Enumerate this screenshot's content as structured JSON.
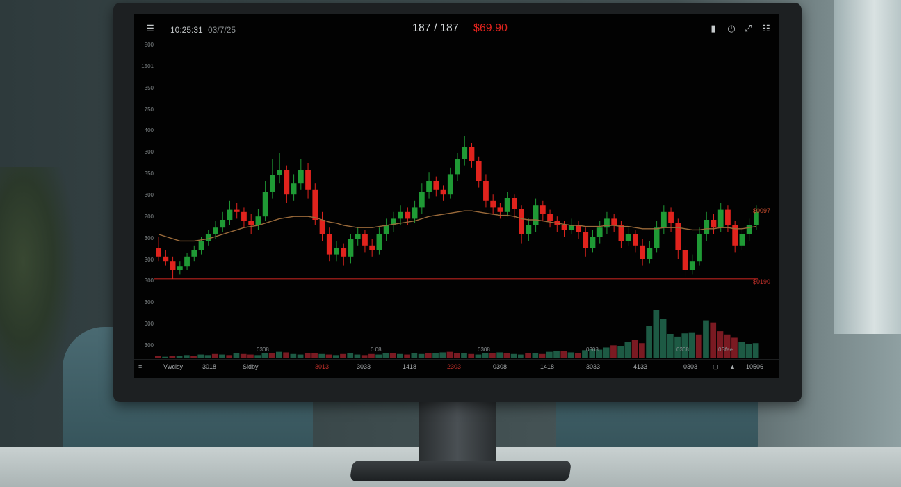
{
  "topbar": {
    "time": "10:25:31",
    "date": "03/7/25",
    "price_main": "187 / 187",
    "price_change": "$69.90",
    "colors": {
      "up": "#1f9a35",
      "down": "#e0231d",
      "ma_line": "#9a6a3a",
      "support_line": "#b8221c"
    },
    "icons": [
      "menu-icon",
      "bookmark-icon",
      "clock-icon",
      "expand-icon",
      "layout-icon"
    ]
  },
  "yaxis": {
    "labels": [
      "500",
      "1501",
      "350",
      "750",
      "400",
      "300",
      "350",
      "300",
      "200",
      "300",
      "300",
      "300",
      "300",
      "900",
      "300"
    ]
  },
  "price_labels": {
    "ma_price": "$0097",
    "support_price": "$0190"
  },
  "sub_labels": [
    "0308",
    "0.08",
    "0308",
    "0308",
    "0308",
    "0Sfee"
  ],
  "bottombar": {
    "items": [
      "Vwcisy",
      "3018",
      "Sidby",
      "3013",
      "3033",
      "1418",
      "2303",
      "0308",
      "1418",
      "3033",
      "4133",
      "0303",
      "10506"
    ]
  },
  "chart_data": {
    "type": "candlestick",
    "ohlc": [
      [
        360,
        352,
        370,
        348
      ],
      [
        352,
        348,
        358,
        344
      ],
      [
        348,
        340,
        352,
        332
      ],
      [
        340,
        343,
        348,
        336
      ],
      [
        343,
        352,
        355,
        340
      ],
      [
        352,
        358,
        362,
        348
      ],
      [
        358,
        366,
        370,
        354
      ],
      [
        366,
        372,
        376,
        362
      ],
      [
        372,
        378,
        384,
        368
      ],
      [
        378,
        385,
        392,
        374
      ],
      [
        385,
        394,
        402,
        380
      ],
      [
        394,
        392,
        400,
        386
      ],
      [
        392,
        384,
        396,
        378
      ],
      [
        384,
        380,
        390,
        372
      ],
      [
        380,
        388,
        395,
        376
      ],
      [
        388,
        410,
        420,
        384
      ],
      [
        410,
        425,
        440,
        404
      ],
      [
        425,
        430,
        445,
        418
      ],
      [
        430,
        408,
        434,
        400
      ],
      [
        408,
        418,
        426,
        402
      ],
      [
        418,
        430,
        440,
        412
      ],
      [
        430,
        412,
        436,
        404
      ],
      [
        412,
        385,
        418,
        380
      ],
      [
        385,
        372,
        392,
        366
      ],
      [
        372,
        354,
        378,
        348
      ],
      [
        354,
        360,
        366,
        348
      ],
      [
        360,
        352,
        364,
        344
      ],
      [
        352,
        368,
        372,
        346
      ],
      [
        368,
        372,
        378,
        362
      ],
      [
        372,
        362,
        376,
        356
      ],
      [
        362,
        358,
        368,
        352
      ],
      [
        358,
        372,
        378,
        354
      ],
      [
        372,
        380,
        386,
        366
      ],
      [
        380,
        386,
        392,
        374
      ],
      [
        386,
        392,
        398,
        380
      ],
      [
        392,
        386,
        396,
        380
      ],
      [
        386,
        396,
        402,
        382
      ],
      [
        396,
        410,
        418,
        390
      ],
      [
        410,
        420,
        428,
        404
      ],
      [
        420,
        412,
        424,
        406
      ],
      [
        412,
        408,
        416,
        402
      ],
      [
        408,
        426,
        432,
        404
      ],
      [
        426,
        440,
        445,
        420
      ],
      [
        440,
        450,
        460,
        434
      ],
      [
        450,
        438,
        454,
        432
      ],
      [
        438,
        420,
        442,
        414
      ],
      [
        420,
        402,
        426,
        396
      ],
      [
        402,
        396,
        408,
        390
      ],
      [
        396,
        392,
        400,
        386
      ],
      [
        392,
        405,
        410,
        388
      ],
      [
        405,
        395,
        408,
        386
      ],
      [
        395,
        372,
        398,
        364
      ],
      [
        372,
        380,
        386,
        366
      ],
      [
        380,
        398,
        404,
        374
      ],
      [
        398,
        390,
        402,
        384
      ],
      [
        390,
        384,
        394,
        378
      ],
      [
        384,
        380,
        388,
        374
      ],
      [
        380,
        376,
        384,
        370
      ],
      [
        376,
        380,
        386,
        372
      ],
      [
        380,
        374,
        384,
        368
      ],
      [
        374,
        360,
        378,
        352
      ],
      [
        360,
        370,
        376,
        356
      ],
      [
        370,
        378,
        384,
        364
      ],
      [
        378,
        386,
        392,
        372
      ],
      [
        386,
        380,
        390,
        374
      ],
      [
        380,
        366,
        384,
        360
      ],
      [
        366,
        372,
        378,
        362
      ],
      [
        372,
        362,
        376,
        356
      ],
      [
        362,
        350,
        368,
        344
      ],
      [
        350,
        360,
        366,
        346
      ],
      [
        360,
        378,
        384,
        356
      ],
      [
        378,
        392,
        398,
        372
      ],
      [
        392,
        382,
        396,
        374
      ],
      [
        382,
        358,
        386,
        350
      ],
      [
        358,
        340,
        362,
        334
      ],
      [
        340,
        348,
        354,
        336
      ],
      [
        348,
        372,
        378,
        344
      ],
      [
        372,
        385,
        392,
        366
      ],
      [
        385,
        378,
        390,
        372
      ],
      [
        378,
        394,
        400,
        374
      ],
      [
        394,
        380,
        398,
        374
      ],
      [
        380,
        362,
        384,
        356
      ],
      [
        362,
        372,
        378,
        358
      ],
      [
        372,
        380,
        386,
        366
      ],
      [
        380,
        392,
        398,
        376
      ]
    ],
    "ma": [
      372,
      370,
      368,
      366,
      366,
      366,
      367,
      368,
      370,
      372,
      374,
      376,
      378,
      379,
      380,
      382,
      384,
      386,
      387,
      388,
      388,
      388,
      387,
      385,
      383,
      382,
      380,
      379,
      378,
      378,
      378,
      379,
      380,
      381,
      382,
      383,
      384,
      386,
      388,
      389,
      390,
      391,
      392,
      393,
      393,
      392,
      391,
      390,
      389,
      389,
      388,
      386,
      385,
      385,
      384,
      383,
      382,
      381,
      380,
      380,
      379,
      379,
      379,
      380,
      380,
      379,
      379,
      378,
      377,
      377,
      377,
      378,
      378,
      378,
      377,
      376,
      376,
      377,
      377,
      378,
      378,
      377,
      377,
      378,
      379
    ],
    "support": 332,
    "volume": [
      4,
      3,
      5,
      4,
      6,
      5,
      7,
      6,
      8,
      7,
      6,
      9,
      8,
      7,
      6,
      10,
      9,
      12,
      11,
      8,
      7,
      9,
      10,
      8,
      7,
      6,
      8,
      9,
      7,
      6,
      8,
      7,
      9,
      10,
      8,
      7,
      9,
      8,
      10,
      9,
      11,
      12,
      10,
      9,
      8,
      7,
      9,
      10,
      11,
      9,
      8,
      7,
      9,
      10,
      8,
      12,
      14,
      13,
      11,
      10,
      15,
      18,
      16,
      20,
      24,
      22,
      30,
      34,
      28,
      60,
      90,
      72,
      45,
      40,
      46,
      48,
      44,
      70,
      66,
      50,
      44,
      38,
      30,
      26,
      28
    ],
    "volume_colors": [
      "down",
      "up",
      "down",
      "up",
      "up",
      "down",
      "up",
      "up",
      "down",
      "up",
      "down",
      "up",
      "down",
      "down",
      "up",
      "up",
      "down",
      "up",
      "down",
      "up",
      "up",
      "down",
      "down",
      "up",
      "down",
      "up",
      "down",
      "up",
      "up",
      "down",
      "down",
      "up",
      "up",
      "down",
      "up",
      "down",
      "up",
      "up",
      "down",
      "up",
      "up",
      "down",
      "down",
      "up",
      "down",
      "up",
      "up",
      "down",
      "up",
      "down",
      "up",
      "up",
      "down",
      "up",
      "down",
      "up",
      "up",
      "down",
      "up",
      "down",
      "up",
      "up",
      "up",
      "up",
      "down",
      "up",
      "up",
      "down",
      "down",
      "up",
      "up",
      "up",
      "up",
      "up",
      "up",
      "up",
      "down",
      "up",
      "down",
      "down",
      "down",
      "down",
      "up",
      "up",
      "up"
    ],
    "y_range": [
      320,
      470
    ],
    "grid": false
  }
}
